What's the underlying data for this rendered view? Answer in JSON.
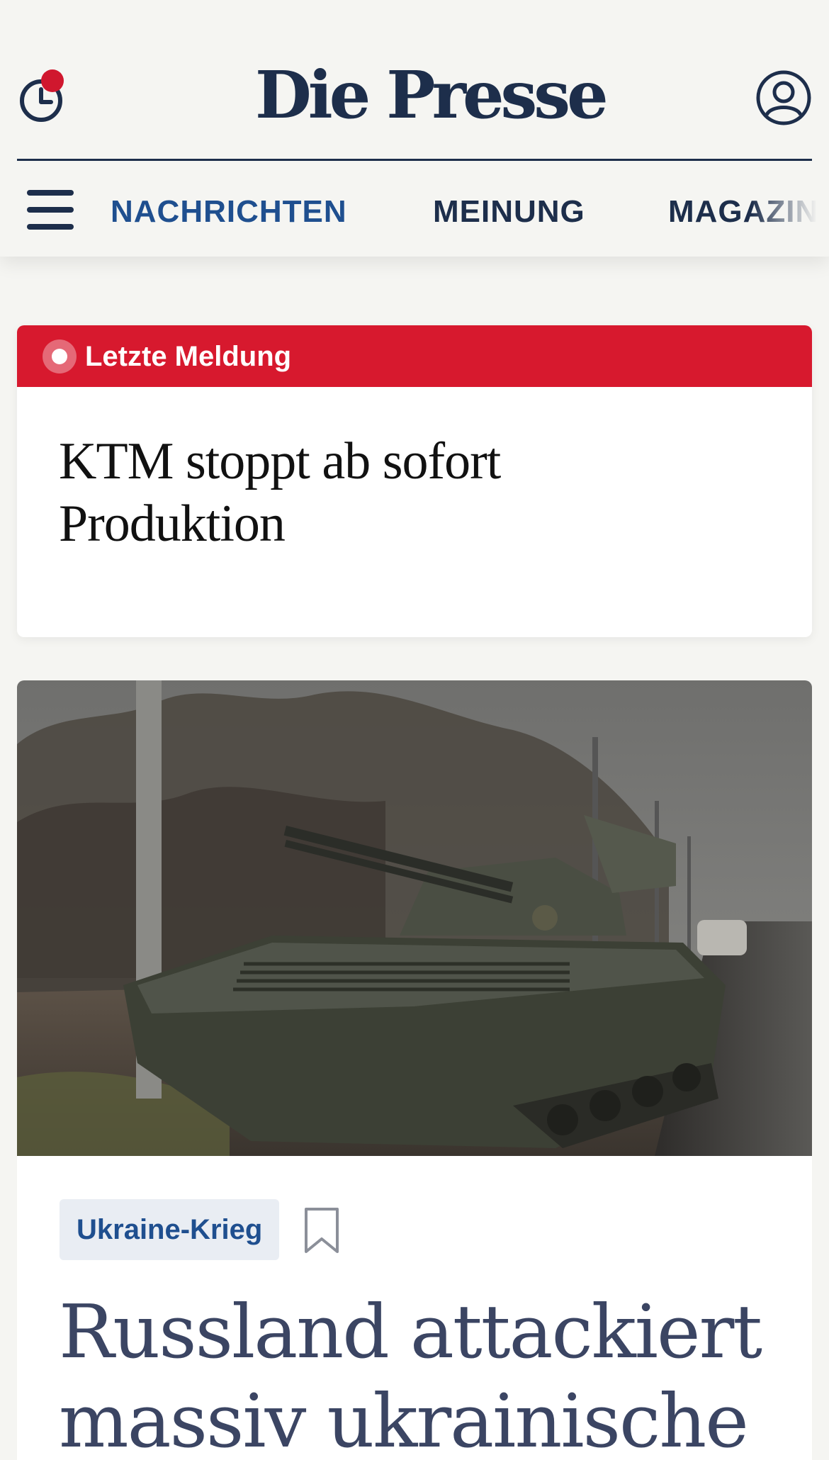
{
  "header": {
    "logo_text": "Die Presse",
    "history_icon": "clock-icon",
    "profile_icon": "user-icon",
    "notification_color": "#d0172e"
  },
  "nav": {
    "menu_icon": "hamburger-icon",
    "tabs": [
      {
        "label": "NACHRICHTEN",
        "active": true
      },
      {
        "label": "MEINUNG",
        "active": false
      },
      {
        "label": "MAGAZIN",
        "active": false
      }
    ]
  },
  "breaking": {
    "label": "Letzte Meldung",
    "headline": "KTM stoppt ab sofort Produktion",
    "bar_color": "#d7192e"
  },
  "lead_article": {
    "image_alt": "tank-photo",
    "tag": "Ukraine-Krieg",
    "bookmark_icon": "bookmark-icon",
    "headline": "Russland attackiert massiv ukrainische"
  },
  "colors": {
    "brand_navy": "#1d2e4b",
    "link_blue": "#1f4f8f",
    "background": "#f5f5f2"
  }
}
